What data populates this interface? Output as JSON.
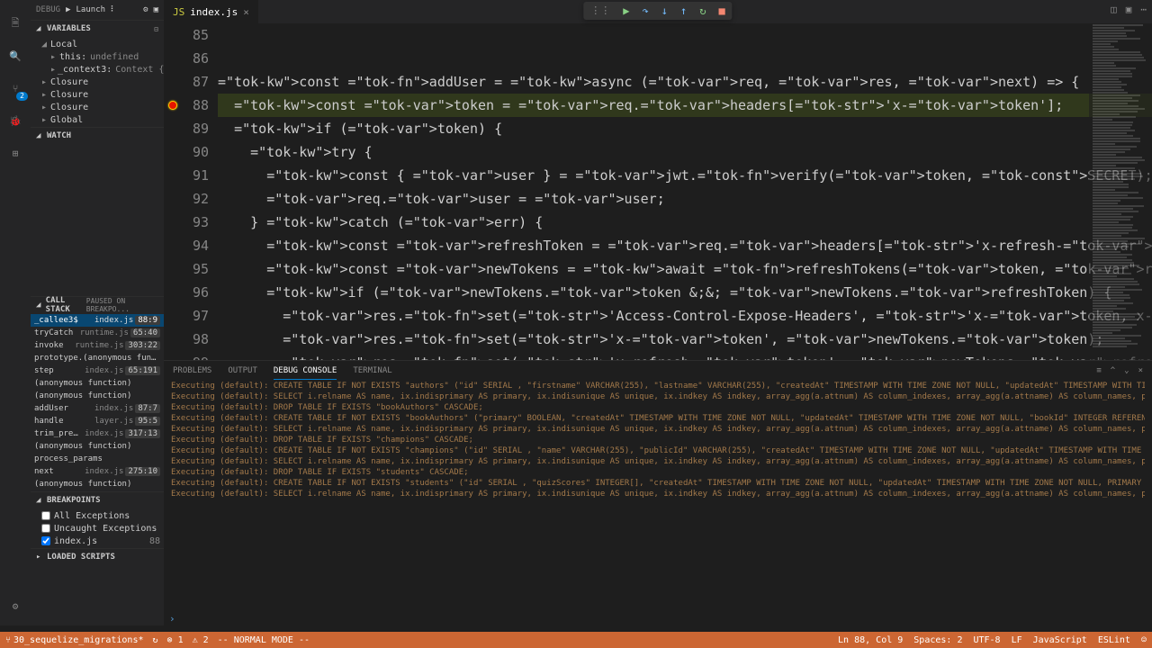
{
  "debugHeader": {
    "label": "DEBUG",
    "config": "Launch ⠇"
  },
  "sections": {
    "variables": "VARIABLES",
    "watch": "WATCH",
    "callstack": "CALL STACK",
    "callstackExtra": "PAUSED ON BREAKPO...",
    "breakpoints": "BREAKPOINTS",
    "loaded": "LOADED SCRIPTS"
  },
  "variables": {
    "scopes": [
      {
        "name": "Local",
        "expanded": true,
        "children": [
          {
            "name": "this:",
            "value": "undefined"
          },
          {
            "name": "_context3:",
            "value": "Context {tryEntri…"
          }
        ]
      },
      {
        "name": "Closure",
        "expanded": false
      },
      {
        "name": "Closure",
        "expanded": false
      },
      {
        "name": "Closure",
        "expanded": false
      },
      {
        "name": "Global",
        "expanded": false
      }
    ]
  },
  "callstack": [
    {
      "fn": "_callee3$",
      "file": "index.js",
      "loc": "88:9",
      "active": true
    },
    {
      "fn": "tryCatch",
      "file": "runtime.js",
      "loc": "65:40"
    },
    {
      "fn": "invoke",
      "file": "runtime.js",
      "loc": "303:22"
    },
    {
      "fn": "prototype.(anonymous functi…",
      "file": "",
      "loc": ""
    },
    {
      "fn": "step",
      "file": "index.js",
      "loc": "65:191"
    },
    {
      "fn": "(anonymous function)",
      "file": "",
      "loc": ""
    },
    {
      "fn": "(anonymous function)",
      "file": "",
      "loc": ""
    },
    {
      "fn": "addUser",
      "file": "index.js",
      "loc": "87:7"
    },
    {
      "fn": "handle",
      "file": "layer.js",
      "loc": "95:5"
    },
    {
      "fn": "trim_prefix",
      "file": "index.js",
      "loc": "317:13"
    },
    {
      "fn": "(anonymous function)",
      "file": "",
      "loc": ""
    },
    {
      "fn": "process_params",
      "file": "",
      "loc": ""
    },
    {
      "fn": "next",
      "file": "index.js",
      "loc": "275:10"
    },
    {
      "fn": "(anonymous function)",
      "file": "",
      "loc": ""
    }
  ],
  "breakpoints": {
    "allExceptions": "All Exceptions",
    "uncaught": "Uncaught Exceptions",
    "items": [
      {
        "file": "index.js",
        "loc": "88",
        "checked": true
      }
    ]
  },
  "tab": {
    "filename": "index.js"
  },
  "code": {
    "startLine": 85,
    "breakpointLine": 88,
    "lines": [
      "",
      "",
      "const addUser = async (req, res, next) => {",
      "  const token = req.headers['x-token'];",
      "  if (token) {",
      "    try {",
      "      const { user } = jwt.verify(token, SECRET);",
      "      req.user = user;",
      "    } catch (err) {",
      "      const refreshToken = req.headers['x-refresh-token'];",
      "      const newTokens = await refreshTokens(token, refreshToken, models, SECRET);",
      "      if (newTokens.token && newTokens.refreshToken) {",
      "        res.set('Access-Control-Expose-Headers', 'x-token, x-refresh-token');",
      "        res.set('x-token', newTokens.token);",
      "        res.set('x-refresh-token', newTokens.refreshToken);"
    ]
  },
  "panelTabs": {
    "problems": "PROBLEMS",
    "output": "OUTPUT",
    "debugConsole": "DEBUG CONSOLE",
    "terminal": "TERMINAL"
  },
  "console": [
    "Executing (default): CREATE TABLE IF NOT EXISTS \"authors\" (\"id\"   SERIAL , \"firstname\" VARCHAR(255), \"lastname\" VARCHAR(255), \"createdAt\" TIMESTAMP WITH TIME ZONE NOT NULL, \"updatedAt\" TIMESTAMP WITH TIME ZONE NOT NULL, PRIMARY KEY (\"id\"));",
    "Executing (default): SELECT i.relname AS name, ix.indisprimary AS primary, ix.indisunique AS unique, ix.indkey AS indkey, array_agg(a.attnum) AS column_indexes, array_agg(a.attname) AS column_names, pg_get_indexdef(ix.indexrelid) AS definition FROM pg_class t, pg_class i, pg_index ix, pg_attribute a WHERE t.oid = ix.indrelid AND i.oid = ix.indexrelid AND a.attrelid = t.oid AND t.relkind = 'r' and t.relname = 'authors' GROUP BY i.relname, ix.indexrelid, ix.indisprimary, ix.indisunique, ix.indkey ORDER BY i.relname;",
    "Executing (default): DROP TABLE IF EXISTS \"bookAuthors\" CASCADE;",
    "Executing (default): CREATE TABLE IF NOT EXISTS \"bookAuthors\" (\"primary\" BOOLEAN, \"createdAt\" TIMESTAMP WITH TIME ZONE NOT NULL, \"updatedAt\" TIMESTAMP WITH TIME ZONE NOT NULL, \"bookId\" INTEGER  REFERENCES \"books\" (\"id\") ON DELETE CASCADE ON UPDATE CASCADE, \"authorId\" INTEGER  REFERENCES \"authors\" (\"id\") ON DELETE CASCADE ON UPDATE CASCADE, PRIMARY KEY (\"bookId\",\"authorId\"));",
    "Executing (default): SELECT i.relname AS name, ix.indisprimary AS primary, ix.indisunique AS unique, ix.indkey AS indkey, array_agg(a.attnum) AS column_indexes, array_agg(a.attname) AS column_names, pg_get_indexdef(ix.indexrelid) AS definition FROM pg_class t, pg_class i, pg_index ix, pg_attribute a WHERE t.oid = ix.indrelid AND i.oid = ix.indexrelid AND a.attrelid = t.oid AND t.relkind = 'r' and t.relname = 'bookAuthors' GROUP BY i.relname, ix.indexrelid, ix.indisprimary, ix.indisunique, ix.indkey ORDER BY i.relname;",
    "Executing (default): DROP TABLE IF EXISTS \"champions\" CASCADE;",
    "Executing (default): CREATE TABLE IF NOT EXISTS \"champions\" (\"id\"   SERIAL , \"name\" VARCHAR(255), \"publicId\" VARCHAR(255), \"createdAt\" TIMESTAMP WITH TIME ZONE NOT NULL, \"updatedAt\" TIMESTAMP WITH TIME ZONE NOT NULL, PRIMARY KEY (\"id\"));",
    "Executing (default): SELECT i.relname AS name, ix.indisprimary AS primary, ix.indisunique AS unique, ix.indkey AS indkey, array_agg(a.attnum) AS column_indexes, array_agg(a.attname) AS column_names, pg_get_indexdef(ix.indexrelid) AS definition FROM pg_class t, pg_class i, pg_index ix, pg_attribute a WHERE t.oid = ix.indrelid AND i.oid = ix.indexrelid AND a.attrelid = t.oid AND t.relkind = 'r' and t.relname = 'champions' GROUP BY i.relname, ix.indexrelid, ix.indisprimary, ix.indisunique, ix.indkey ORDER BY i.relname;",
    "Executing (default): DROP TABLE IF EXISTS \"students\" CASCADE;",
    "Executing (default): CREATE TABLE IF NOT EXISTS \"students\" (\"id\"   SERIAL , \"quizScores\" INTEGER[], \"createdAt\" TIMESTAMP WITH TIME ZONE NOT NULL, \"updatedAt\" TIMESTAMP WITH TIME ZONE NOT NULL, PRIMARY KEY (\"id\"));",
    "Executing (default): SELECT i.relname AS name, ix.indisprimary AS primary, ix.indisunique AS unique, ix.indkey AS indkey, array_agg(a.attnum) AS column_indexes, array_agg(a.attname) AS column_names, pg_get_indexdef(ix.indexrelid) AS definition FROM pg_class t, pg_class i, pg_index ix, pg_attribute a WHERE t.oid = ix.indrelid AND i.oid = ix.indexrelid AND a.attrelid = t.oid AND t.relkind = 'r' and t.relname = 'students' GROUP BY i.relname, ix.indexrelid, ix.indisprimary, ix.indisunique, ix.indkey ORDER BY i.relname;"
  ],
  "consolePrompt": "›",
  "statusbar": {
    "branch": "30_sequelize_migrations*",
    "sync": "↻",
    "errors": "⊗ 1",
    "warnings": "⚠ 2",
    "mode": "-- NORMAL MODE --",
    "lncol": "Ln 88, Col 9",
    "spaces": "Spaces: 2",
    "encoding": "UTF-8",
    "eol": "LF",
    "lang": "JavaScript",
    "eslint": "ESLint",
    "feedback": "☺"
  }
}
